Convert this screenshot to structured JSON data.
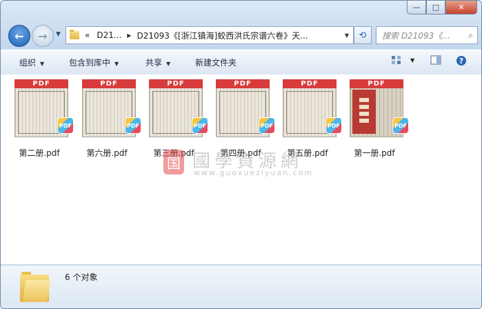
{
  "window": {
    "controls": {
      "minimize": "—",
      "maximize": "□",
      "close": "✕"
    }
  },
  "nav": {
    "back_glyph": "←",
    "forward_glyph": "→",
    "breadcrumb": {
      "chevrons": "«",
      "crumb1": "D21...",
      "crumb2": "D21093《[浙江镇海]蛟西洪氏宗谱六卷》天..."
    },
    "search_placeholder": "搜索 D21093《...",
    "refresh_glyph": "⟲",
    "search_glyph": "⌕"
  },
  "toolbar": {
    "organize": "组织",
    "include_library": "包含到库中",
    "share": "共享",
    "new_folder": "新建文件夹"
  },
  "files": [
    {
      "name": "第二册.pdf",
      "thumb_label": "PDF",
      "cover": "plain"
    },
    {
      "name": "第六册.pdf",
      "thumb_label": "PDF",
      "cover": "plain"
    },
    {
      "name": "第三册.pdf",
      "thumb_label": "PDF",
      "cover": "plain"
    },
    {
      "name": "第四册.pdf",
      "thumb_label": "PDF",
      "cover": "plain"
    },
    {
      "name": "第五册.pdf",
      "thumb_label": "PDF",
      "cover": "plain"
    },
    {
      "name": "第一册.pdf",
      "thumb_label": "PDF",
      "cover": "red"
    }
  ],
  "badge_label": "PDF",
  "watermark": {
    "seal": "国",
    "title": "國學資源網",
    "url": "www.guoxueziyuan.com"
  },
  "status": {
    "count": "6 个对象"
  },
  "colors": {
    "pdf_red": "#d83b3b",
    "accent": "#1d5fb0"
  }
}
